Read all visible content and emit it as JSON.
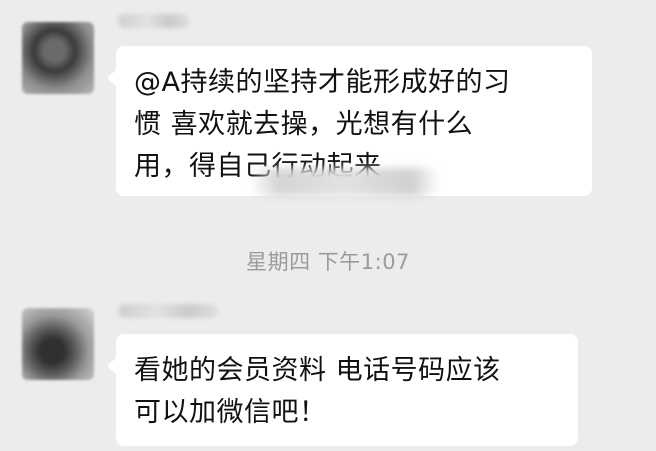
{
  "messages": [
    {
      "sender": "other",
      "lines": [
        "@A持续的坚持才能形成好的习",
        "惯 喜欢就去操，光想有什么",
        "用，得自己行动起来"
      ]
    },
    {
      "sender": "other",
      "lines": [
        "看她的会员资料 电话号码应该",
        "可以加微信吧！"
      ]
    }
  ],
  "timestamp": "星期四 下午1:07",
  "colors": {
    "background": "#ececec",
    "bubble": "#ffffff",
    "timestamp_text": "#9b9b9b"
  }
}
